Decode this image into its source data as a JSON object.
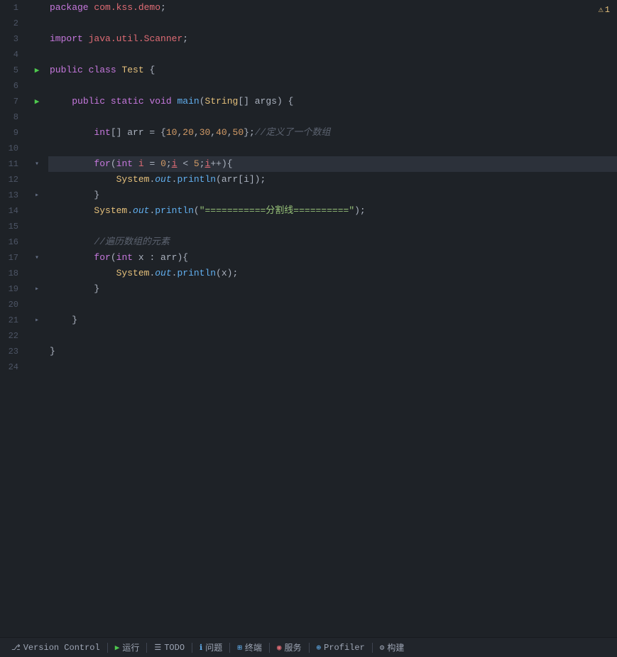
{
  "editor": {
    "background": "#1e2227",
    "warning_count": "1",
    "lines": [
      {
        "num": 1,
        "gutter": "",
        "content": "package_line",
        "highlighted": false
      },
      {
        "num": 2,
        "gutter": "",
        "content": "empty",
        "highlighted": false
      },
      {
        "num": 3,
        "gutter": "",
        "content": "import_line",
        "highlighted": false
      },
      {
        "num": 4,
        "gutter": "",
        "content": "empty",
        "highlighted": false
      },
      {
        "num": 5,
        "gutter": "run",
        "content": "class_decl",
        "highlighted": false
      },
      {
        "num": 6,
        "gutter": "",
        "content": "empty",
        "highlighted": false
      },
      {
        "num": 7,
        "gutter": "run",
        "content": "main_decl",
        "highlighted": false
      },
      {
        "num": 8,
        "gutter": "",
        "content": "empty",
        "highlighted": false
      },
      {
        "num": 9,
        "gutter": "",
        "content": "arr_init",
        "highlighted": false
      },
      {
        "num": 10,
        "gutter": "",
        "content": "empty",
        "highlighted": false
      },
      {
        "num": 11,
        "gutter": "fold",
        "content": "for_loop1",
        "highlighted": true
      },
      {
        "num": 12,
        "gutter": "",
        "content": "println_arr",
        "highlighted": false
      },
      {
        "num": 13,
        "gutter": "fold",
        "content": "close_brace_indent2",
        "highlighted": false
      },
      {
        "num": 14,
        "gutter": "",
        "content": "println_sep",
        "highlighted": false
      },
      {
        "num": 15,
        "gutter": "",
        "content": "empty",
        "highlighted": false
      },
      {
        "num": 16,
        "gutter": "",
        "content": "comment_foreach",
        "highlighted": false
      },
      {
        "num": 17,
        "gutter": "fold",
        "content": "for_loop2",
        "highlighted": false
      },
      {
        "num": 18,
        "gutter": "",
        "content": "println_x",
        "highlighted": false
      },
      {
        "num": 19,
        "gutter": "fold",
        "content": "close_brace_indent1",
        "highlighted": false
      },
      {
        "num": 20,
        "gutter": "",
        "content": "empty",
        "highlighted": false
      },
      {
        "num": 21,
        "gutter": "fold",
        "content": "close_brace_method",
        "highlighted": false
      },
      {
        "num": 22,
        "gutter": "",
        "content": "empty",
        "highlighted": false
      },
      {
        "num": 23,
        "gutter": "",
        "content": "close_brace_class",
        "highlighted": false
      },
      {
        "num": 24,
        "gutter": "",
        "content": "empty",
        "highlighted": false
      }
    ]
  },
  "statusbar": {
    "items": [
      {
        "icon": "⎇",
        "label": "Version Control",
        "name": "version-control"
      },
      {
        "icon": "▶",
        "label": "运行",
        "name": "run"
      },
      {
        "icon": "☰",
        "label": "TODO",
        "name": "todo"
      },
      {
        "icon": "ℹ",
        "label": "问题",
        "name": "problems"
      },
      {
        "icon": "⊞",
        "label": "终端",
        "name": "terminal"
      },
      {
        "icon": "◉",
        "label": "服务",
        "name": "services"
      },
      {
        "icon": "⊕",
        "label": "Profiler",
        "name": "profiler"
      },
      {
        "icon": "⚙",
        "label": "构建",
        "name": "build"
      }
    ]
  }
}
